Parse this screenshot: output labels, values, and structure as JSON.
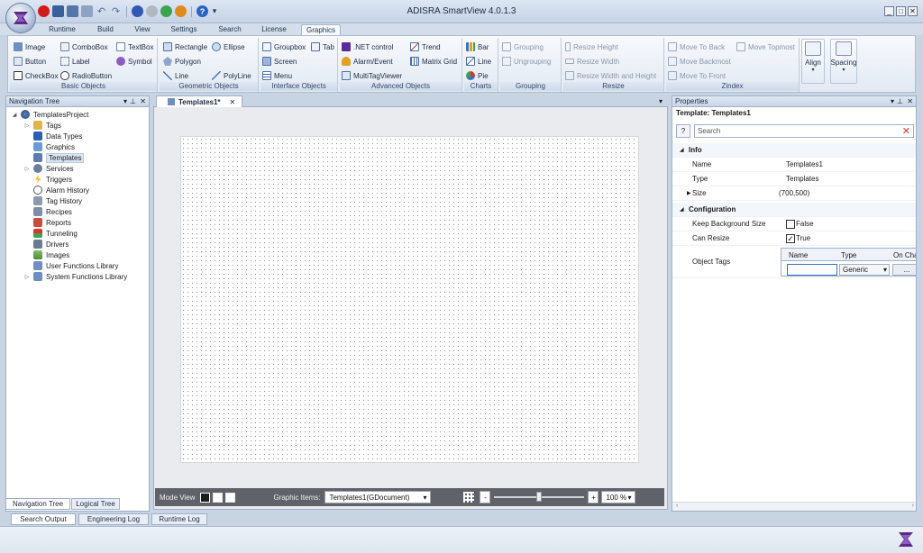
{
  "app": {
    "title": "ADISRA SmartView 4.0.1.3"
  },
  "window_controls": [
    "_",
    "□",
    "✕"
  ],
  "ribbon_tabs": [
    "Runtime",
    "Build",
    "View",
    "Settings",
    "Search",
    "License",
    "Graphics"
  ],
  "ribbon_groups": {
    "basic_objects": {
      "title": "Basic Objects",
      "items": [
        "Image",
        "ComboBox",
        "TextBox",
        "Button",
        "Label",
        "Symbol",
        "CheckBox",
        "RadioButton"
      ]
    },
    "geometric_objects": {
      "title": "Geometric Objects",
      "items": [
        "Rectangle",
        "Ellipse",
        "Polygon",
        "Line",
        "PolyLine"
      ]
    },
    "interface_objects": {
      "title": "Interface Objects",
      "items": [
        "Groupbox",
        "Tab",
        "Screen",
        "Menu"
      ]
    },
    "advanced_objects": {
      "title": "Advanced Objects",
      "items": [
        ".NET control",
        "Trend",
        "Alarm/Event",
        "Matrix Grid",
        "MultiTagViewer"
      ]
    },
    "charts": {
      "title": "Charts",
      "items": [
        "Bar",
        "Line",
        "Pie"
      ]
    },
    "grouping": {
      "title": "Grouping",
      "items": [
        "Grouping",
        "Ungrouping"
      ]
    },
    "resize": {
      "title": "Resize",
      "items": [
        "Resize Height",
        "Resize Width",
        "Resize Width and Height"
      ]
    },
    "zindex": {
      "title": "Zindex",
      "items": [
        "Move To Back",
        "Move Topmost",
        "Move Backmost",
        "Move To Front"
      ]
    },
    "align": {
      "label": "Align"
    },
    "spacing": {
      "label": "Spacing"
    }
  },
  "navigation": {
    "title": "Navigation Tree",
    "root": "TemplatesProject",
    "items": [
      "Tags",
      "Data Types",
      "Graphics",
      "Templates",
      "Services",
      "Triggers",
      "Alarm History",
      "Tag History",
      "Recipes",
      "Reports",
      "Tunneling",
      "Drivers",
      "Images",
      "User Functions Library",
      "System Functions Library"
    ],
    "tabs": [
      "Navigation Tree",
      "Logical Tree"
    ]
  },
  "bottom_tabs": [
    "Search Output",
    "Engineering Log",
    "Runtime Log"
  ],
  "document": {
    "tab_title": "Templates1*",
    "mode_view_label": "Mode View",
    "graphic_items_label": "Graphic Items:",
    "graphic_items_value": "Templates1(GDocument)",
    "zoom_value": "100 %",
    "zoom_level": 0.5
  },
  "properties": {
    "title": "Properties",
    "header_label": "Template:",
    "header_value": "Templates1",
    "help_label": "?",
    "search_placeholder": "Search",
    "sections": {
      "info": "Info",
      "configuration": "Configuration"
    },
    "rows": {
      "name": {
        "label": "Name",
        "value": "Templates1"
      },
      "type": {
        "label": "Type",
        "value": "Templates"
      },
      "size": {
        "label": "Size",
        "value": "(700,500)"
      },
      "keep_background": {
        "label": "Keep Background Size",
        "value": "False"
      },
      "can_resize": {
        "label": "Can Resize",
        "value": "True"
      },
      "object_tags": {
        "label": "Object Tags"
      }
    },
    "object_tags_grid": {
      "headers": [
        "Name",
        "Type",
        "On Cha"
      ],
      "type_value": "Generic",
      "ellipsis": "..."
    }
  }
}
